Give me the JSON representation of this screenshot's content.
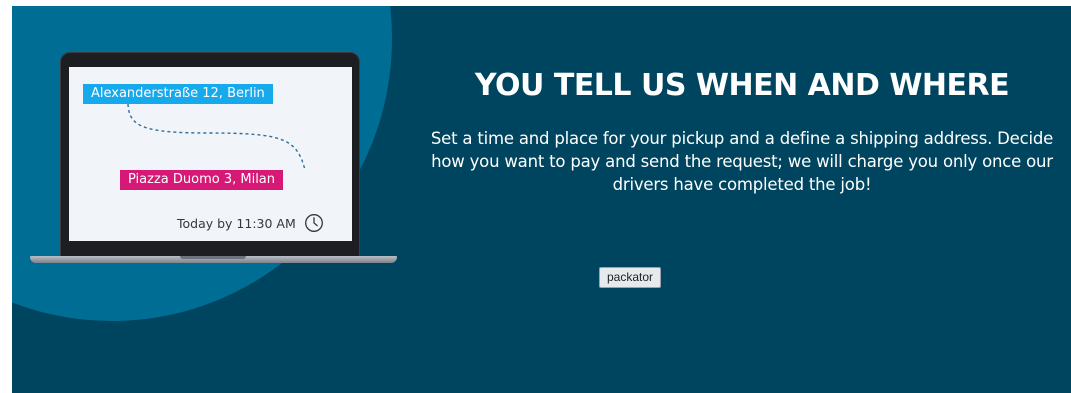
{
  "hero": {
    "pickup_address": "Alexanderstraße 12, Berlin",
    "delivery_address": "Piazza Duomo 3, Milan",
    "eta_text": "Today by 11:30 AM",
    "headline": "YOU TELL US WHEN AND WHERE",
    "description": "Set a time and place for your pickup and a define a shipping address. Decide how you want to pay and send the request; we will charge you only once our drivers have completed the job!",
    "button_label": "packator"
  },
  "icons": {
    "eta": "clock-icon"
  },
  "colors": {
    "background": "#00455f",
    "blob": "#006e94",
    "pickup_tag": "#16a9ec",
    "delivery_tag": "#d61877",
    "screen": "#f1f4f8"
  }
}
